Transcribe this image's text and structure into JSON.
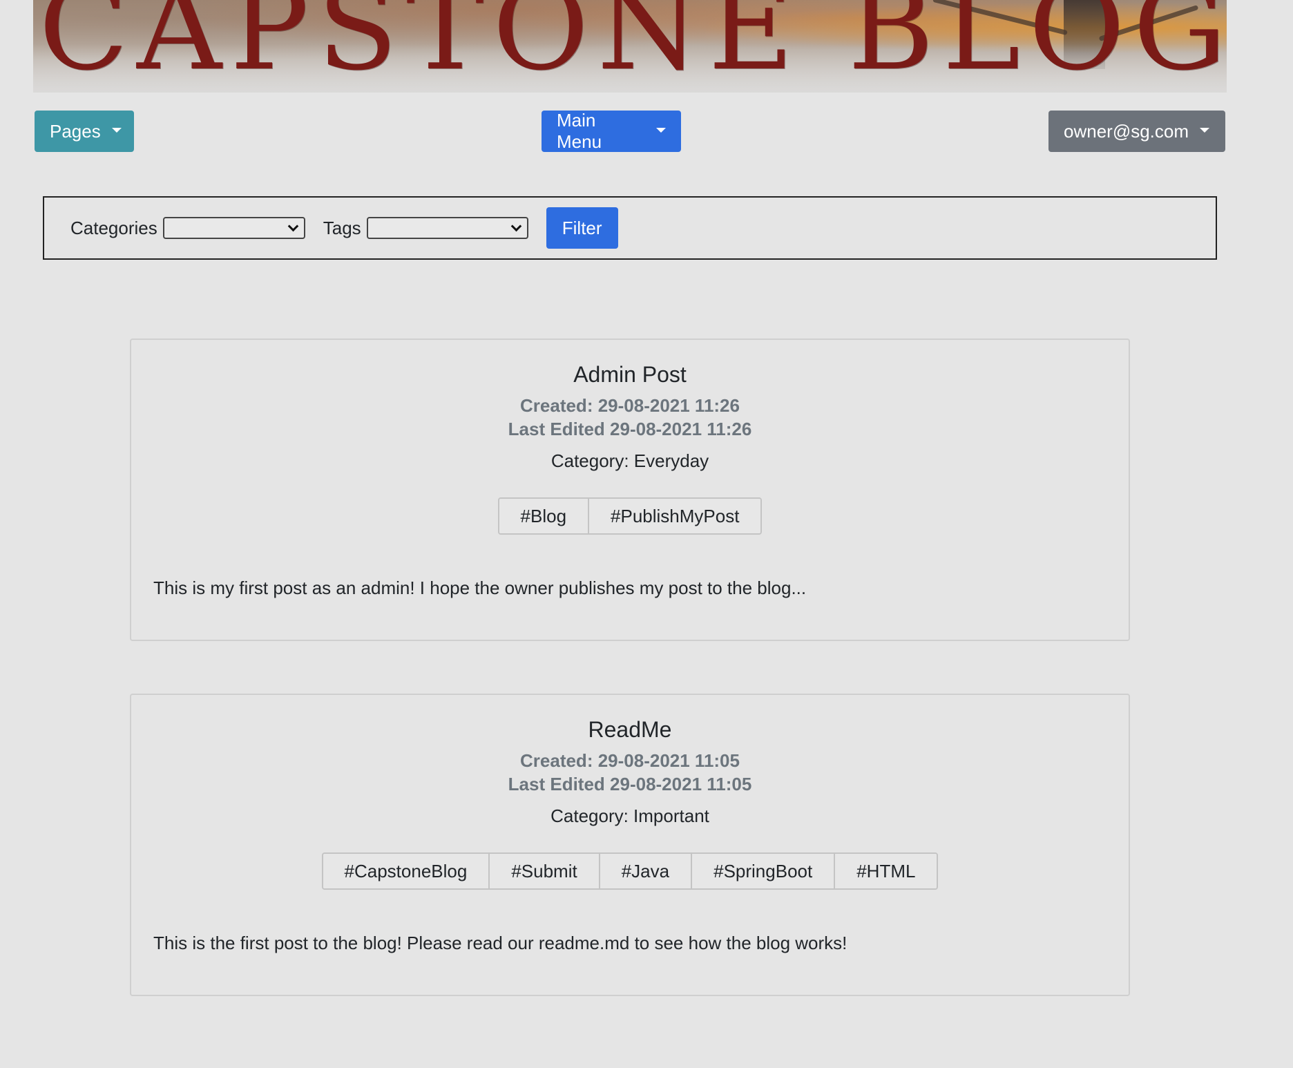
{
  "banner": {
    "title": "CAPSTONE BLOG"
  },
  "nav": {
    "pages_label": "Pages",
    "main_menu_label": "Main Menu",
    "user_label": "owner@sg.com"
  },
  "filter": {
    "categories_label": "Categories",
    "categories_selected": "",
    "tags_label": "Tags",
    "tags_selected": "",
    "button_label": "Filter"
  },
  "posts": [
    {
      "title": "Admin Post",
      "created": "Created: 29-08-2021 11:26",
      "edited": "Last Edited 29-08-2021 11:26",
      "category": "Category: Everyday",
      "tags": [
        "#Blog",
        "#PublishMyPost"
      ],
      "body": "This is my first post as an admin! I hope the owner publishes my post to the blog..."
    },
    {
      "title": "ReadMe",
      "created": "Created: 29-08-2021 11:05",
      "edited": "Last Edited 29-08-2021 11:05",
      "category": "Category: Important",
      "tags": [
        "#CapstoneBlog",
        "#Submit",
        "#Java",
        "#SpringBoot",
        "#HTML"
      ],
      "body": "This is the first post to the blog! Please read our readme.md to see how the blog works!"
    }
  ],
  "colors": {
    "pages_button": "#3e97a6",
    "primary": "#2e6de0",
    "secondary": "#6c727a",
    "banner_text": "#7a1b17",
    "muted_text": "#6c757d"
  }
}
